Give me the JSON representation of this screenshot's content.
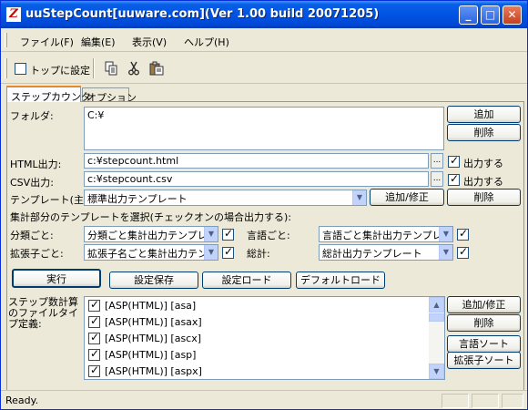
{
  "window": {
    "title": "uuStepCount[uuware.com](Ver 1.00 build 20071205)",
    "icon_char": "Z",
    "controls": {
      "minimize": "_",
      "maximize": "□",
      "close": "✕"
    }
  },
  "menu": {
    "items": [
      {
        "label": "ファイル(F)"
      },
      {
        "label": "編集(E)"
      },
      {
        "label": "表示(V)"
      },
      {
        "label": "ヘルプ(H)"
      }
    ]
  },
  "toolbar": {
    "topmost_label": "トップに設定",
    "topmost_checked": false,
    "icons": [
      "copy-icon",
      "cut-icon",
      "paste-icon"
    ]
  },
  "tabs": [
    {
      "label": "ステップカウンタ",
      "active": true
    },
    {
      "label": "オプション",
      "active": false
    }
  ],
  "folder": {
    "label": "フォルダ:",
    "value": "C:¥",
    "add_button": "追加",
    "delete_button": "削除"
  },
  "html_output": {
    "label": "HTML出力:",
    "value": "c:¥stepcount.html",
    "browse": "...",
    "enable_label": "出力する",
    "enabled": true
  },
  "csv_output": {
    "label": "CSV出力:",
    "value": "c:¥stepcount.csv",
    "browse": "...",
    "enable_label": "出力する",
    "enabled": true
  },
  "template_main": {
    "label": "テンプレート(主):",
    "value": "標準出力テンプレート",
    "add_edit_button": "追加/修正",
    "delete_button": "削除"
  },
  "aggregate": {
    "heading": "集計部分のテンプレートを選択(チェックオンの場合出力する):",
    "by_category": {
      "label": "分類ごと:",
      "value": "分類ごと集計出力テンプレ",
      "checked": true
    },
    "by_language": {
      "label": "言語ごと:",
      "value": "言語ごと集計出力テンプレ",
      "checked": true
    },
    "by_extension": {
      "label": "拡張子ごと:",
      "value": "拡張子名ごと集計出力テン",
      "checked": true
    },
    "total": {
      "label": "総計:",
      "value": "総計出力テンプレート",
      "checked": true
    }
  },
  "actions": {
    "run": "実行",
    "save_settings": "設定保存",
    "load_settings": "設定ロード",
    "default_load": "デフォルトロード"
  },
  "file_types": {
    "label": "ステップ数計算のファイルタイプ定義:",
    "items": [
      {
        "label": "[ASP(HTML)] [asa]",
        "checked": true
      },
      {
        "label": "[ASP(HTML)] [asax]",
        "checked": true
      },
      {
        "label": "[ASP(HTML)] [ascx]",
        "checked": true
      },
      {
        "label": "[ASP(HTML)] [asp]",
        "checked": true
      },
      {
        "label": "[ASP(HTML)] [aspx]",
        "checked": true
      }
    ],
    "add_edit_button": "追加/修正",
    "delete_button": "削除",
    "sort_language_button": "言語ソート",
    "sort_extension_button": "拡張子ソート"
  },
  "status": {
    "text": "Ready."
  }
}
